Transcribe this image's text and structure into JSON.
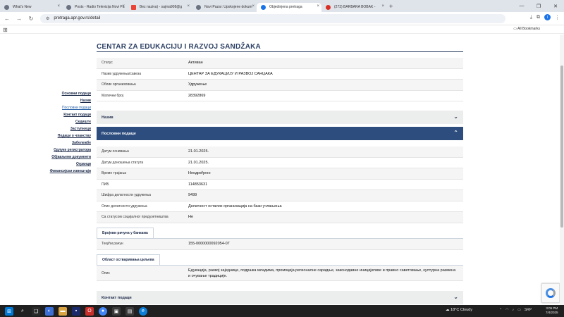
{
  "browser": {
    "tabs": [
      {
        "label": "What's New",
        "icon": "globe-icon"
      },
      {
        "label": "Posts - Radio Televizija Novi Pa",
        "icon": "globe-icon"
      },
      {
        "label": "Bez naziva) - sajma908@g",
        "icon": "gmail-icon"
      },
      {
        "label": "Novi Pazar: Upokojene dokum",
        "icon": "globe-icon"
      },
      {
        "label": "Objedinjena pretraga",
        "icon": "globe-icon",
        "active": true
      },
      {
        "label": "(273) BARBARA BOBAK - ",
        "icon": "youtube-icon"
      }
    ],
    "new_tab_glyph": "+",
    "url": "pretraga.apr.gov.rs/detail",
    "all_bookmarks": "All Bookmarks",
    "profile_initial": "I"
  },
  "page": {
    "title": "CENTAR ZA EDUKACIJU I RAZVOJ SANDŽAKA",
    "sidenav": [
      {
        "label": "Основни подаци"
      },
      {
        "label": "Назив"
      },
      {
        "label": "Пословни подаци",
        "current": true
      },
      {
        "label": "Контакт подаци"
      },
      {
        "label": "Седиште"
      },
      {
        "label": "Заступници"
      },
      {
        "label": "Подаци о чланству"
      },
      {
        "label": "Забележбе"
      },
      {
        "label": "Одлуке регистратора"
      },
      {
        "label": "Објављени документи"
      },
      {
        "label": "Огранци"
      },
      {
        "label": "Финансијски извештаји"
      }
    ],
    "basic": [
      {
        "k": "Статус",
        "v": "Активан"
      },
      {
        "k": "Назив удружења/савеза",
        "v": "ЦЕНТАР ЗА ЕДУКАЦИЈУ И РАЗВОЈ САНЏАКА"
      },
      {
        "k": "Облик организовања",
        "v": "Удружење"
      },
      {
        "k": "Матични број",
        "v": "28392869"
      }
    ],
    "section_naziv": "Назив",
    "section_business": "Пословни подаци",
    "business": [
      {
        "k": "Датум оснивања",
        "v": "21.01.2025."
      },
      {
        "k": "Датум доношења статута",
        "v": "21.01.2025."
      },
      {
        "k": "Време трајања",
        "v": "Неодређено"
      },
      {
        "k": "ПИБ",
        "v": "114853631"
      },
      {
        "k": "Шифра делатности удружења",
        "v": "9499"
      },
      {
        "k": "Опис делатности удружења",
        "v": "Делатност осталих организација на бази учлањења"
      },
      {
        "k": "Са статусом социјалног предузетништва",
        "v": "Не"
      }
    ],
    "accounts_tab": "Бројеви рачуна у банкама",
    "accounts": [
      {
        "k": "Текући рачун",
        "v": "155-0000000092054-07"
      }
    ],
    "goals_tab": "Област остваривања циљева",
    "goals": [
      {
        "k": "Опис",
        "v": "Едукација, развој заједнице, подршка младима, промоција регионалне сарадње, законодавне иницијативе и правно саветовање, културна размена и очување традиције."
      }
    ],
    "section_contact": "Контакт подаци"
  },
  "taskbar": {
    "weather": "18°C  Cloudy",
    "lang": "SRP",
    "time": "3:05 PM",
    "date": "7/4/2025"
  }
}
